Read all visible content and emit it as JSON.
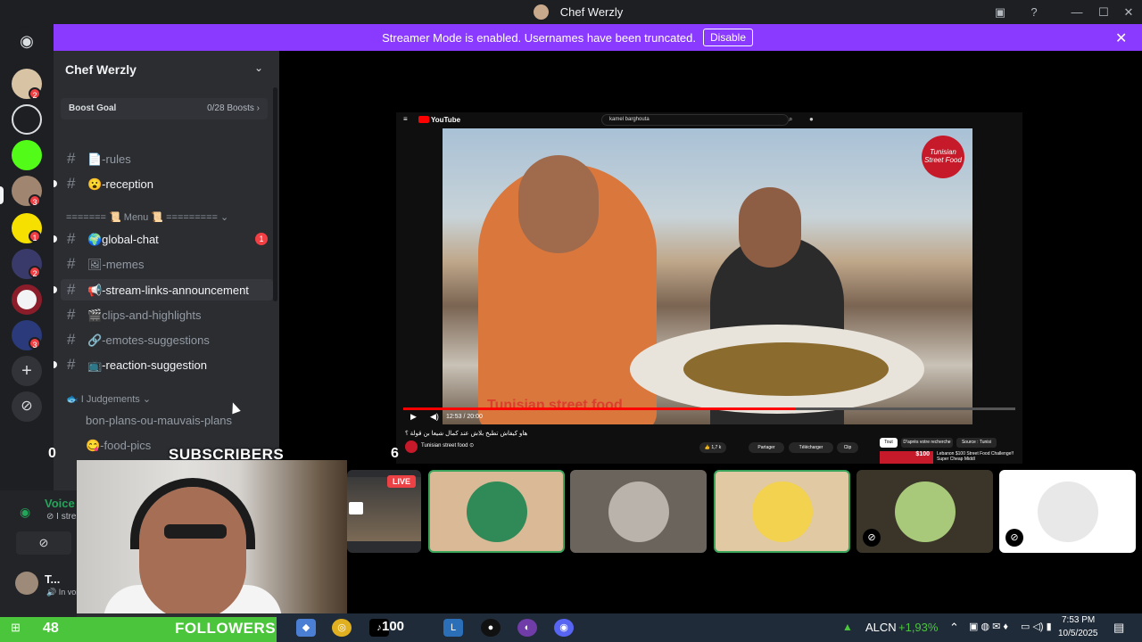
{
  "window": {
    "title": "Chef Werzly",
    "minimize": "—",
    "maximize": "☐",
    "close": "✕"
  },
  "banner": {
    "message": "Streamer Mode is enabled. Usernames have been truncated.",
    "disable_label": "Disable",
    "close": "✕"
  },
  "rail": {
    "badges": [
      "2",
      "3",
      "1",
      "2",
      "3"
    ]
  },
  "sidebar": {
    "server_name": "Chef Werzly",
    "boost_goal": "Boost Goal",
    "boost_count": "0/28 Boosts ›",
    "channels": [
      {
        "name": "📄-rules",
        "unread": false
      },
      {
        "name": "😮-reception",
        "unread": true
      },
      {
        "name": "🌍global-chat",
        "unread": true,
        "badge": "1"
      },
      {
        "name": "🖼-memes",
        "unread": false
      },
      {
        "name": "📢-stream-links-announcement",
        "unread": true
      },
      {
        "name": "🎬clips-and-highlights",
        "unread": false
      },
      {
        "name": "🔗-emotes-suggestions",
        "unread": false
      },
      {
        "name": "📺-reaction-suggestion",
        "unread": true
      },
      {
        "name": "bon-plans-ou-mauvais-plans",
        "unread": false
      },
      {
        "name": "😋-food-pics",
        "unread": false
      }
    ],
    "category_menu": "======= 📜 Menu 📜 ========= ⌄",
    "category_judgements": "🐟 I Judgements ⌄"
  },
  "stream": {
    "search_query": "kamel barghouta",
    "logo_text": "YouTube",
    "time": "12:53 / 20:00",
    "progress": 0.64,
    "overlay_title": "Tunisian street food",
    "badge_text": "Tunisian Street Food",
    "video_title": "هاو كيفاش تطبخ بلاش عند كمال شيعا بن قولة ؟",
    "channel": "Tunisian street food ⊙",
    "likes": "👍 1,7 k",
    "share": "Partager",
    "download": "Télécharger",
    "clip": "Clip",
    "chips": [
      "Tout",
      "D'après votre recherche",
      "Source : Tunisi"
    ],
    "sugg_price": "$100",
    "sugg_title": "Lebanon $100 Street Food Challenge!! Super Cheap Middl"
  },
  "overlay": {
    "subscribers_count": "0",
    "subscribers_label": "SUBSCRIBERS",
    "right_count": "6",
    "followers_count": "48",
    "followers_label": "FOLLOWERS",
    "live_label": "LIVE"
  },
  "voice": {
    "title": "Voice C",
    "sub": "⊘ I stre",
    "user": "T...",
    "status": "🔊 In voi"
  },
  "taskbar": {
    "ticker": "ALCN",
    "change": "+1,93%",
    "time": "7:53 PM",
    "date": "10/5/2025",
    "badge_100": "100"
  },
  "colors": {
    "accent": "#8a39ff",
    "followers_bar": "#4bc53b",
    "speaking": "#3ba55c",
    "mention": "#f23f43"
  }
}
